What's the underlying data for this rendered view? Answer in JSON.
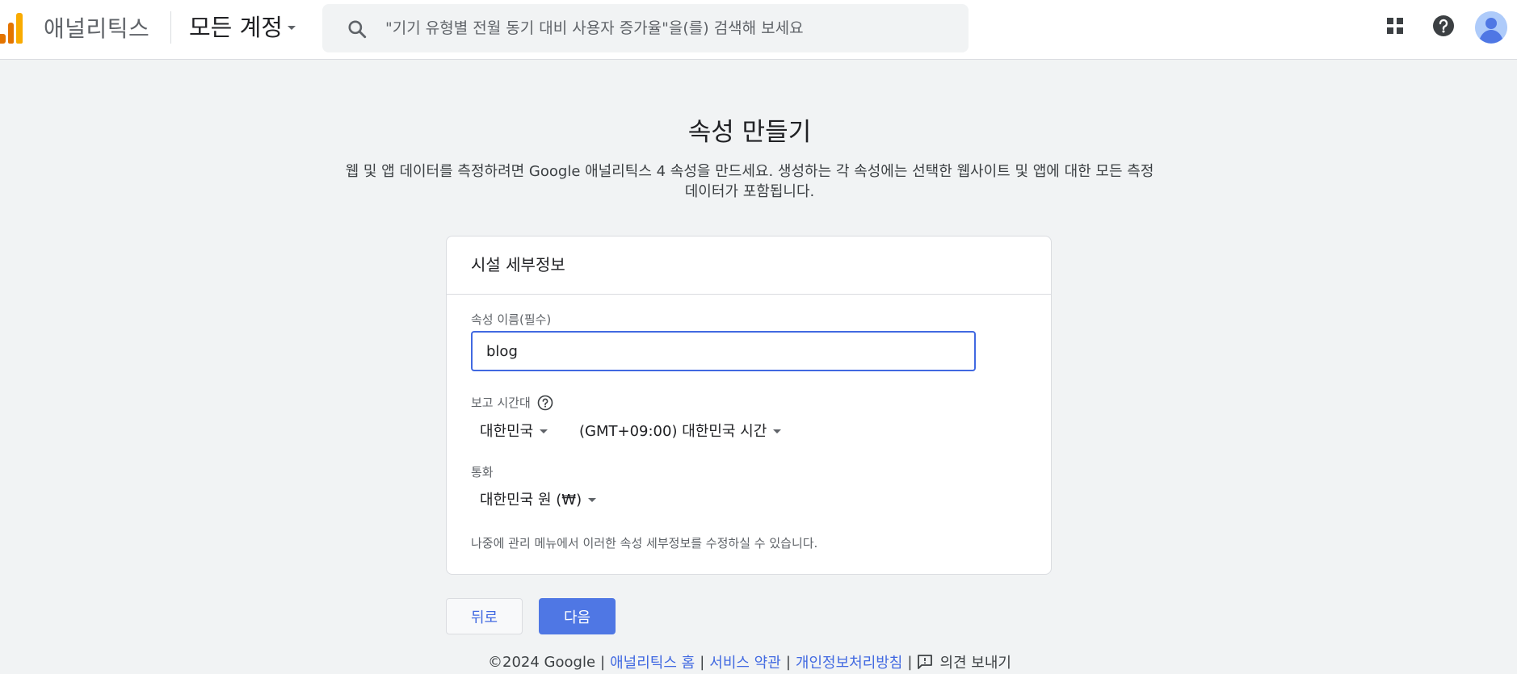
{
  "header": {
    "app_name": "애널리틱스",
    "account_switcher_label": "모든 계정",
    "search_placeholder": "\"기기 유형별 전월 동기 대비 사용자 증가율\"을(를) 검색해 보세요",
    "icons": [
      "analytics-logo",
      "search-icon",
      "apps-grid-icon",
      "help-icon",
      "account-avatar"
    ]
  },
  "main": {
    "title": "속성 만들기",
    "description": "웹 및 앱 데이터를 측정하려면 Google 애널리틱스 4 속성을 만드세요. 생성하는 각 속성에는 선택한 웹사이트 및 앱에 대한 모든 측정 데이터가 포함됩니다."
  },
  "card": {
    "title": "시설 세부정보",
    "property_name_label": "속성 이름(필수)",
    "property_name_value": "blog",
    "timezone_label": "보고 시간대",
    "country_value": "대한민국",
    "timezone_value": "(GMT+09:00) 대한민국 시간",
    "currency_label": "통화",
    "currency_value": "대한민국 원 (₩)",
    "note": "나중에 관리 메뉴에서 이러한 속성 세부정보를 수정하실 수 있습니다."
  },
  "actions": {
    "back_label": "뒤로",
    "next_label": "다음"
  },
  "footer": {
    "copyright": "©2024 Google",
    "separator": "|",
    "links": [
      "애널리틱스 홈",
      "서비스 약관",
      "개인정보처리방침"
    ],
    "feedback_label": "의견 보내기"
  },
  "colors": {
    "accent": "#4169e1",
    "primary_button": "#4f77e4",
    "logo_orange": "#e37400",
    "logo_yellow": "#f9ab00",
    "page_background": "#f1f3f4"
  }
}
